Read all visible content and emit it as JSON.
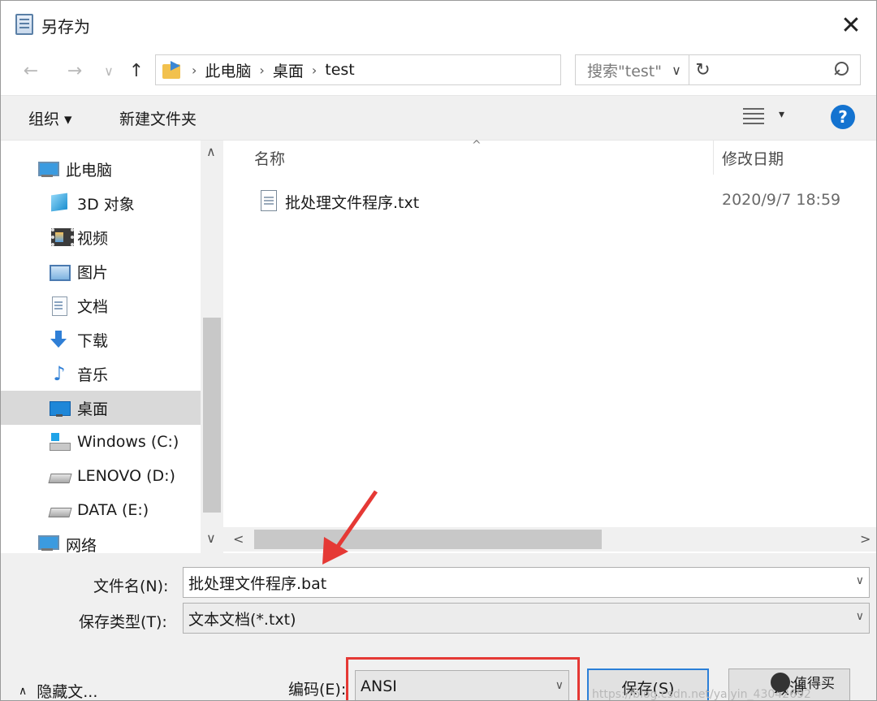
{
  "window": {
    "title": "另存为",
    "close_glyph": "✕"
  },
  "nav": {
    "back": "←",
    "forward": "→",
    "recent": "∨",
    "up": "↑"
  },
  "address": {
    "crumbs": [
      "此电脑",
      "桌面",
      "test"
    ],
    "separator": "›",
    "dropdown": "∨",
    "refresh": "↻"
  },
  "search": {
    "placeholder": "搜索\"test\""
  },
  "toolbar": {
    "organize": "组织 ▾",
    "new_folder": "新建文件夹",
    "view_arrow": "▾",
    "help": "?"
  },
  "sidebar": {
    "items": [
      {
        "label": "此电脑",
        "icon": "computer-icon"
      },
      {
        "label": "3D 对象",
        "icon": "3d-objects-icon"
      },
      {
        "label": "视频",
        "icon": "video-icon"
      },
      {
        "label": "图片",
        "icon": "pictures-icon"
      },
      {
        "label": "文档",
        "icon": "documents-icon"
      },
      {
        "label": "下载",
        "icon": "download-icon"
      },
      {
        "label": "音乐",
        "icon": "music-icon"
      },
      {
        "label": "桌面",
        "icon": "desktop-icon",
        "selected": true
      },
      {
        "label": "Windows (C:)",
        "icon": "windows-drive-icon"
      },
      {
        "label": "LENOVO (D:)",
        "icon": "drive-icon"
      },
      {
        "label": "DATA (E:)",
        "icon": "drive-icon"
      },
      {
        "label": "网络",
        "icon": "network-icon"
      }
    ],
    "scroll_up": "∧",
    "scroll_down": "∨"
  },
  "files": {
    "columns": {
      "name": "名称",
      "date": "修改日期"
    },
    "sort_glyph": "^",
    "rows": [
      {
        "name": "批处理文件程序.txt",
        "date": "2020/9/7 18:59"
      }
    ],
    "scroll_left": "<",
    "scroll_right": ">"
  },
  "form": {
    "filename_label": "文件名(N):",
    "filename_value": "批处理文件程序.bat",
    "filetype_label": "保存类型(T):",
    "filetype_value": "文本文档(*.txt)",
    "combo_arrow": "∨",
    "hide_folders": "隐藏文...",
    "hide_glyph": "∧",
    "encoding_label": "编码(E):",
    "encoding_value": "ANSI",
    "save_button": "保存(S)",
    "cancel_button": "取消"
  },
  "watermark": {
    "text": "值得买",
    "url": "https://blog.csdn.net/yaiyin_43042692"
  },
  "colors": {
    "accent": "#1473d0",
    "highlight_box": "#e53935",
    "arrow": "#e53935",
    "selected_bg": "#d9d9d9"
  }
}
